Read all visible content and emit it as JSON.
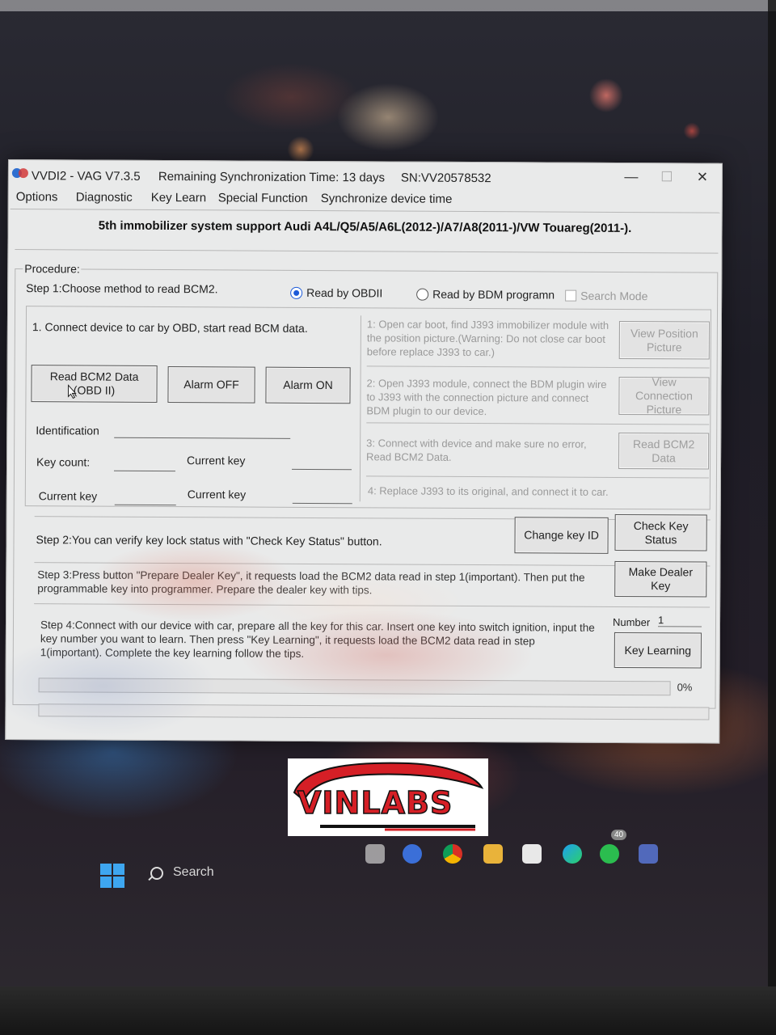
{
  "window": {
    "app_name": "VVDI2 - VAG V7.3.5",
    "sync_time": "Remaining Synchronization Time: 13 days",
    "serial": "SN:VV20578532",
    "minimize": "—",
    "maximize": "☐",
    "close": "✕"
  },
  "menu": [
    "Options",
    "Diagnostic",
    "Key Learn",
    "Special Function",
    "Synchronize device time"
  ],
  "info": "5th immobilizer system support Audi A4L/Q5/A5/A6L(2012-)/A7/A8(2011-)/VW Touareg(2011-).",
  "procedure": {
    "label": "Procedure:",
    "step1": "Step 1:Choose method to read BCM2.",
    "radio_obd": "Read by OBDII",
    "radio_bdm": "Read by BDM programn",
    "search_mode": "Search Mode",
    "obd": {
      "instruction": "1. Connect device to car by OBD, start read BCM data.",
      "read_btn_line1": "Read BCM2 Data",
      "read_btn_line2": "(OBD II)",
      "alarm_off": "Alarm OFF",
      "alarm_on": "Alarm ON",
      "identification": "Identification",
      "key_count": "Key count:",
      "current_key_1": "Current key",
      "current_key_2": "Current key",
      "current_key_3": "Current key"
    },
    "bdm": {
      "step1": "1: Open car boot, find J393 immobilizer module with the position picture.(Warning: Do not close car boot before replace J393 to car.)",
      "view_position": "View Position Picture",
      "step2": "2: Open J393 module, connect the BDM plugin wire to J393 with the connection picture and connect BDM plugin to our device.",
      "view_connection": "View Connection Picture",
      "step3": "3: Connect with device and make sure no error, Read BCM2 Data.",
      "read_bcm2": "Read BCM2 Data",
      "step4": "4: Replace J393 to its original, and connect it to car."
    },
    "step2": "Step 2:You can verify key lock status with \"Check Key Status\" button.",
    "change_key_id": "Change key ID",
    "check_key_status": "Check Key Status",
    "step3": "Step 3:Press button \"Prepare Dealer Key\", it requests load the BCM2 data read in step 1(important). Then put the programmable key into programmer. Prepare the dealer key with tips.",
    "make_dealer_key": "Make Dealer Key",
    "step4": "Step 4:Connect with our device with car, prepare all the key for this car. Insert one key into switch ignition, input the key number you want to learn. Then press \"Key Learning\", it requests load the BCM2 data read in step 1(important). Complete the key learning follow the tips.",
    "number_label": "Number",
    "number_value": "1",
    "key_learning": "Key Learning",
    "progress_percent": "0%",
    "progress_value": 0
  },
  "logo": {
    "text": "VINLABS",
    "color_red": "#d51f26",
    "color_black": "#111111"
  },
  "taskbar": {
    "search": "Search",
    "badge": "40"
  },
  "colors": {
    "window_bg": "#e9eaea",
    "radio_accent": "#1e5bd8",
    "windows_blue": "#3ea6f0"
  }
}
